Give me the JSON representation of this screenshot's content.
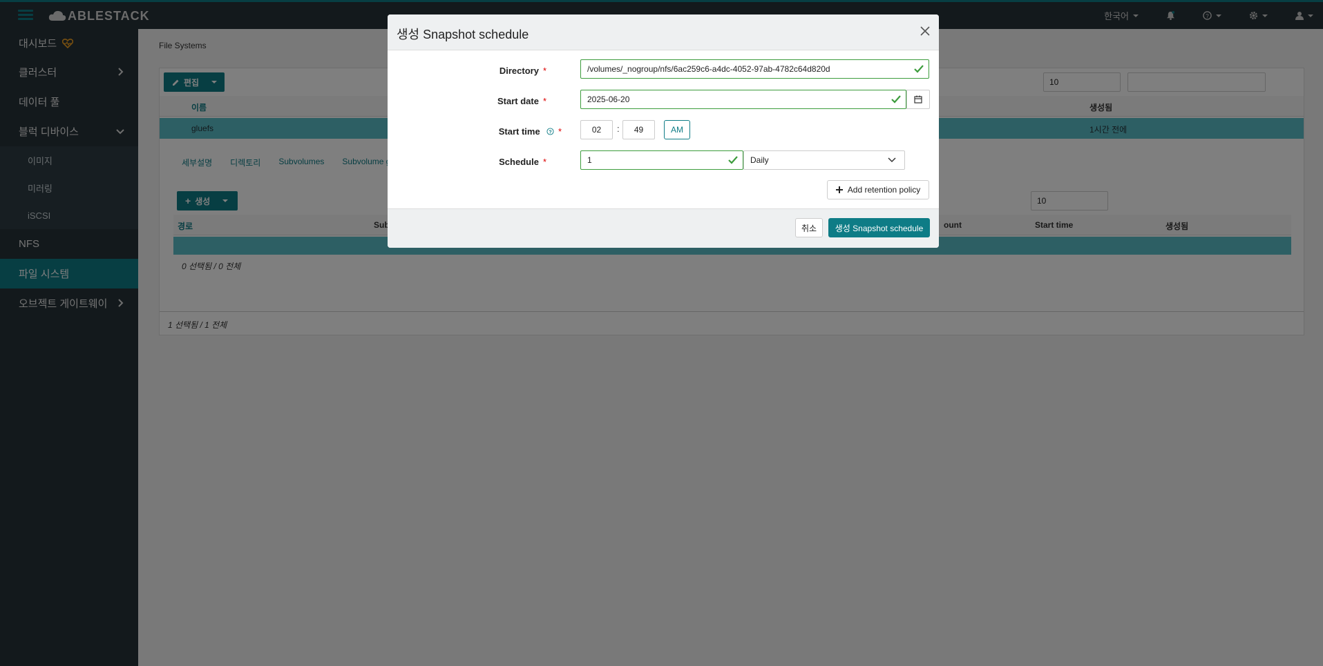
{
  "app": {
    "brand": "ABLESTACK"
  },
  "navbar": {
    "language": "한국어"
  },
  "sidebar": {
    "items": [
      {
        "label": "대시보드"
      },
      {
        "label": "클러스터"
      },
      {
        "label": "데이터 풀"
      },
      {
        "label": "블럭 디바이스"
      },
      {
        "label": "NFS"
      },
      {
        "label": "파일 시스템"
      },
      {
        "label": "오브젝트 게이트웨이"
      }
    ],
    "sub_items": [
      {
        "label": "이미지"
      },
      {
        "label": "미러링"
      },
      {
        "label": "iSCSI"
      }
    ]
  },
  "main": {
    "breadcrumb": "File Systems",
    "edit_button": "편집",
    "page_size": "10",
    "table": {
      "col_name": "이름",
      "col_created": "생성됨",
      "row_name": "gluefs",
      "row_created": "1시간 전에"
    },
    "tabs": [
      {
        "label": "세부설명"
      },
      {
        "label": "디렉토리"
      },
      {
        "label": "Subvolumes"
      },
      {
        "label": "Subvolume g"
      }
    ],
    "subpanel": {
      "create_button": "생성",
      "page_size": "10",
      "col_path": "경로",
      "col_sub": "Sub",
      "col_count": "ount",
      "col_start_time": "Start time",
      "col_created": "생성됨",
      "footer": "0 선택됨 / 0 전체"
    },
    "footer": "1 선택됨 / 1 전체"
  },
  "modal": {
    "title": "생성 Snapshot schedule",
    "fields": {
      "directory_label": "Directory",
      "directory_value": "/volumes/_nogroup/nfs/6ac259c6-a4dc-4052-97ab-4782c64d820d",
      "start_date_label": "Start date",
      "start_date_value": "2025-06-20",
      "start_time_label": "Start time",
      "hour": "02",
      "time_sep": ":",
      "minute": "49",
      "ampm": "AM",
      "schedule_label": "Schedule",
      "schedule_value": "1",
      "schedule_unit": "Daily",
      "required_mark": "*"
    },
    "add_retention_button": "Add retention policy",
    "cancel_button": "취소",
    "submit_button": "생성 Snapshot schedule"
  },
  "colors": {
    "accent": "#0e7c86",
    "sidebar_bg": "#263238",
    "valid_green": "#3c9c3c",
    "heart_orange": "#f0a020"
  }
}
